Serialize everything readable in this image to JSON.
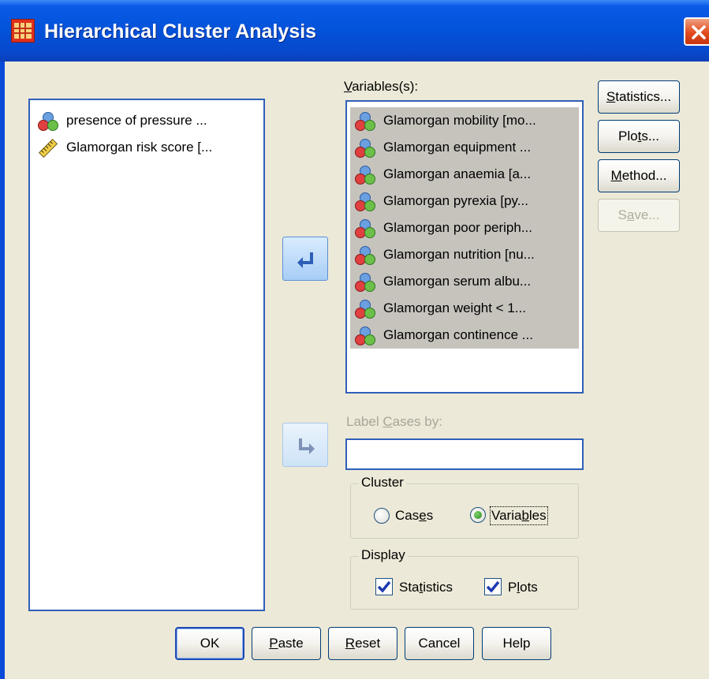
{
  "window": {
    "title": "Hierarchical Cluster Analysis"
  },
  "source_list": {
    "items": [
      {
        "label": "presence of pressure ...",
        "icon": "nominal-variable-icon"
      },
      {
        "label": "Glamorgan risk score [...",
        "icon": "scale-variable-icon"
      }
    ]
  },
  "variables": {
    "label": "Variables(s):",
    "items": [
      "Glamorgan mobility [mo...",
      "Glamorgan equipment ...",
      "Glamorgan anaemia [a...",
      "Glamorgan pyrexia [py...",
      "Glamorgan poor periph...",
      "Glamorgan nutrition [nu...",
      "Glamorgan serum albu...",
      "Glamorgan weight < 1...",
      "Glamorgan continence ..."
    ]
  },
  "label_cases": {
    "label": "Label Cases by:",
    "value": ""
  },
  "cluster_group": {
    "legend": "Cluster",
    "options": [
      "Cases",
      "Variables"
    ],
    "selected": "Variables"
  },
  "display_group": {
    "legend": "Display",
    "options": [
      "Statistics",
      "Plots"
    ],
    "checked": [
      "Statistics",
      "Plots"
    ]
  },
  "side_buttons": {
    "statistics": "Statistics...",
    "plots": "Plots...",
    "method": "Method...",
    "save": "Save..."
  },
  "bottom_buttons": {
    "ok": "OK",
    "paste": "Paste",
    "reset": "Reset",
    "cancel": "Cancel",
    "help": "Help"
  },
  "colors": {
    "title_blue": "#0352d8",
    "dialog_bg": "#ece9d8",
    "selection": "#c6c3bd",
    "listbox_border": "#2f5fb8"
  }
}
